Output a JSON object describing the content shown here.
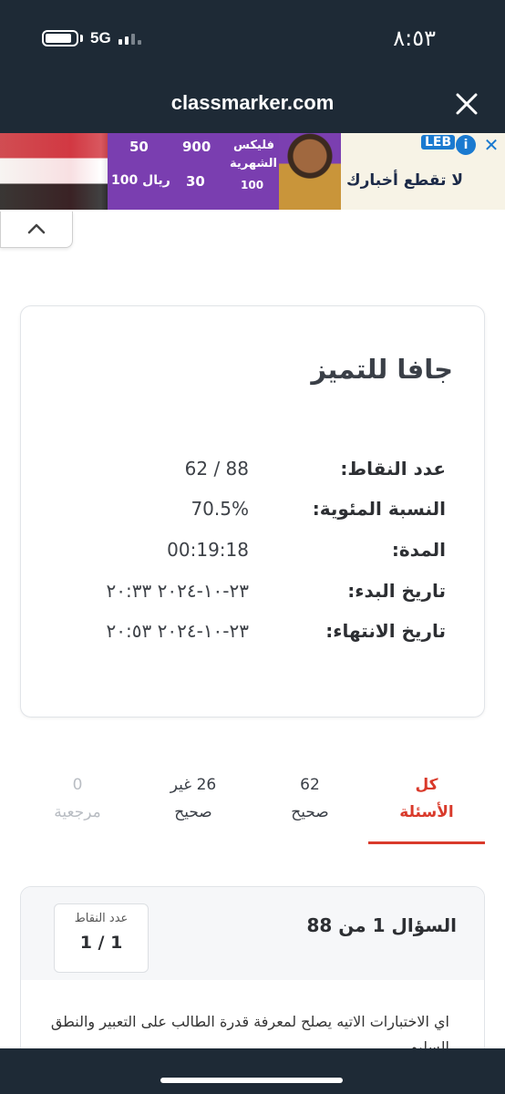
{
  "status_bar": {
    "time": "٨:٥٣",
    "network": "5G"
  },
  "browser": {
    "url": "classmarker.com"
  },
  "ad": {
    "purple_texts": [
      "50",
      "900",
      "فليكس",
      "الشهرية",
      "100",
      "30",
      "100 ريال"
    ],
    "tagline": "لا تقطع أخبارك",
    "logo": "LEB"
  },
  "results": {
    "title": "جافا للتميز",
    "rows": [
      {
        "label": "عدد النقاط:",
        "value": "62 / 88"
      },
      {
        "label": "النسبة المئوية:",
        "value": "70.5%"
      },
      {
        "label": "المدة:",
        "value": "00:19:18"
      },
      {
        "label": "تاريخ البدء:",
        "value": "٢٣-١٠-٢٠٢٤ ٢٠:٣٣"
      },
      {
        "label": "تاريخ الانتهاء:",
        "value": "٢٣-١٠-٢٠٢٤ ٢٠:٥٣"
      }
    ]
  },
  "tabs": {
    "all": {
      "line1": "كل",
      "line2": "الأسئلة"
    },
    "correct": {
      "line1": "62",
      "line2": "صحيح"
    },
    "incorrect": {
      "line1": "26 غير",
      "line2": "صحيح"
    },
    "review": {
      "line1": "0",
      "line2": "مرجعية"
    }
  },
  "question": {
    "title": "السؤال 1 من 88",
    "points_label": "عدد النقاط",
    "points_value": "1 / 1",
    "text": "اي الاختبارات الاتيه يصلح لمعرفة قدرة الطالب على التعبير والنطق السليم"
  },
  "colors": {
    "chrome": "#1e2a36",
    "accent": "#d93a2b",
    "muted": "#b9bdc3"
  }
}
